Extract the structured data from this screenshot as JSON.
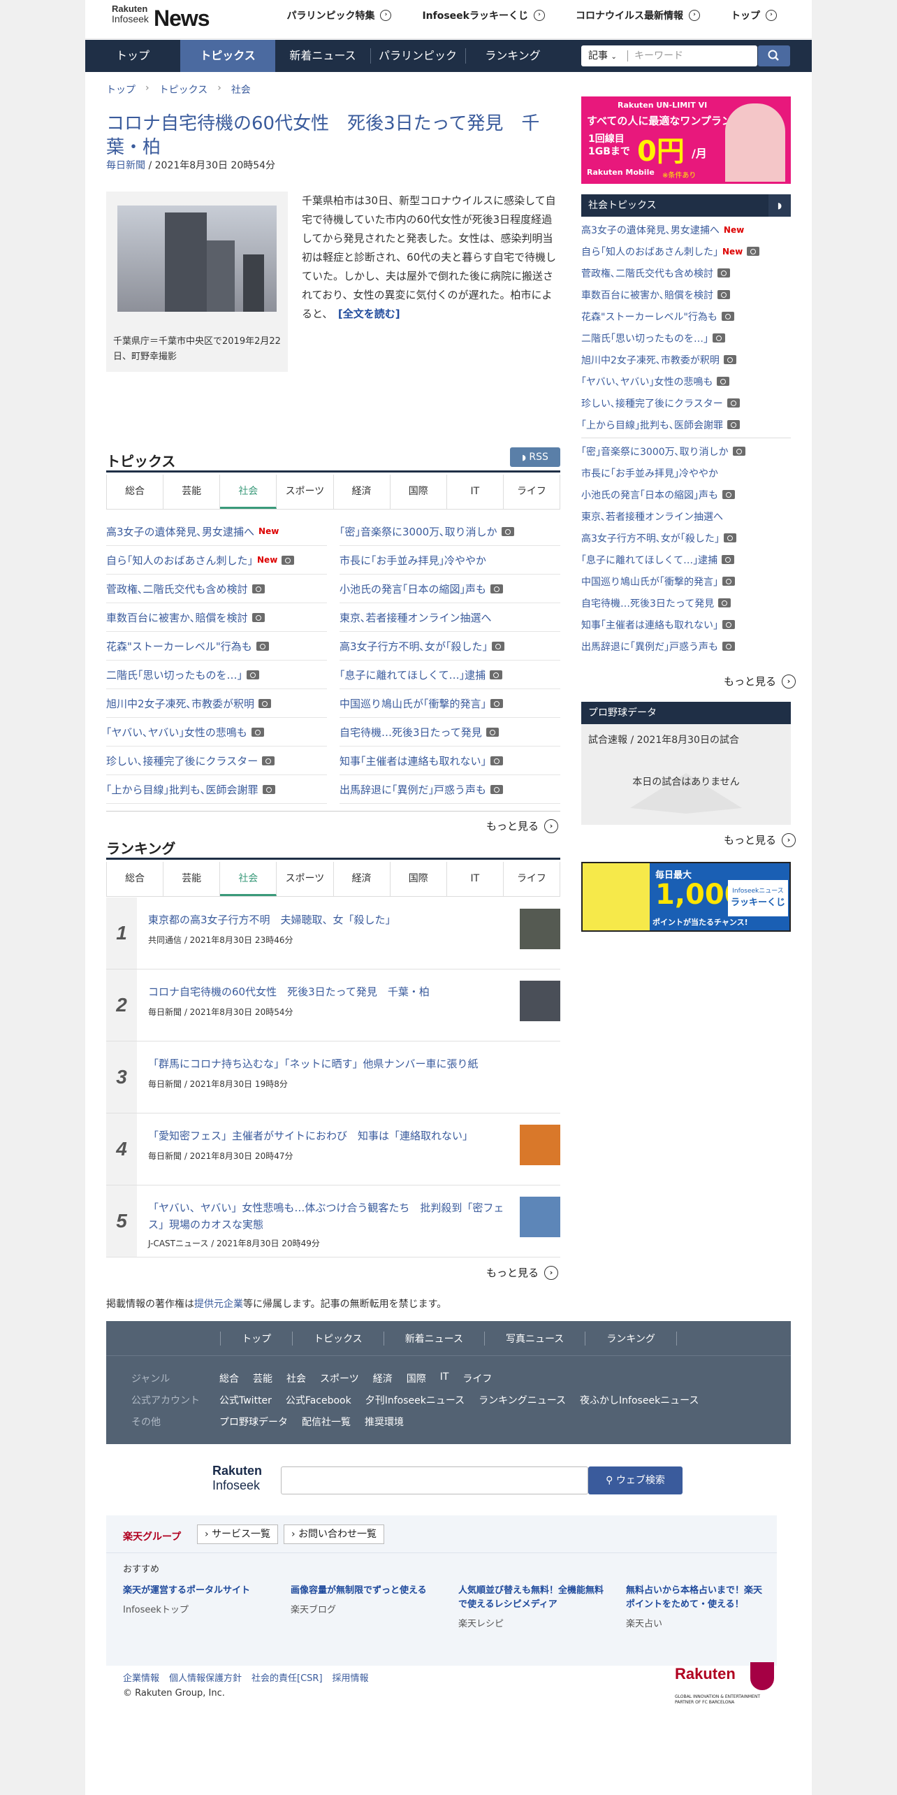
{
  "header": {
    "logo_top": "Rakuten",
    "logo_sub": "Infoseek",
    "logo_news": "News",
    "links": [
      "パラリンピック特集",
      "Infoseekラッキーくじ",
      "コロナウイルス最新情報",
      "トップ"
    ]
  },
  "nav": {
    "tabs": [
      "トップ",
      "トピックス",
      "新着ニュース",
      "パラリンピック",
      "ランキング"
    ],
    "active": "トピックス",
    "search_select": "記事",
    "search_placeholder": "キーワード"
  },
  "breadcrumb": [
    "トップ",
    "トピックス",
    "社会"
  ],
  "article": {
    "title": "コロナ自宅待機の60代女性　死後3日たって発見　千葉・柏",
    "source": "毎日新聞",
    "date": "2021年8月30日 20時54分",
    "caption": "千葉県庁＝千葉市中央区で2019年2月22日、町野幸撮影",
    "body": "千葉県柏市は30日、新型コロナウイルスに感染して自宅で待機していた市内の60代女性が死後3日程度経過してから発見されたと発表した。女性は、感染判明当初は軽症と診断され、60代の夫と暮らす自宅で待機していた。しかし、夫は屋外で倒れた後に病院に搬送されており、女性の異変に気付くのが遅れた。柏市によると、",
    "read_more": "[全文を読む]"
  },
  "topics": {
    "heading": "トピックス",
    "rss": "RSS",
    "tabs": [
      "総合",
      "芸能",
      "社会",
      "スポーツ",
      "経済",
      "国際",
      "IT",
      "ライフ"
    ],
    "active_tab": "社会",
    "left": [
      {
        "text": "高3女子の遺体発見､男女逮捕へ",
        "new": "New",
        "cam": false
      },
      {
        "text": "自ら｢知人のおばあさん刺した｣",
        "new": "New",
        "cam": true
      },
      {
        "text": "菅政権､二階氏交代も含め検討",
        "new": "",
        "cam": true
      },
      {
        "text": "車数百台に被害か､賠償を検討",
        "new": "",
        "cam": true
      },
      {
        "text": "花森\"ストーカーレベル\"行為も",
        "new": "",
        "cam": true
      },
      {
        "text": "二階氏｢思い切ったものを…｣",
        "new": "",
        "cam": true
      },
      {
        "text": "旭川中2女子凍死､市教委が釈明",
        "new": "",
        "cam": true
      },
      {
        "text": "｢ヤバい､ヤバい｣女性の悲鳴も",
        "new": "",
        "cam": true
      },
      {
        "text": "珍しい､接種完了後にクラスター",
        "new": "",
        "cam": true
      },
      {
        "text": "｢上から目線｣批判も､医師会謝罪",
        "new": "",
        "cam": true
      }
    ],
    "right": [
      {
        "text": "｢密｣音楽祭に3000万､取り消しか",
        "cam": true
      },
      {
        "text": "市長に｢お手並み拝見｣冷ややか",
        "cam": false
      },
      {
        "text": "小池氏の発言｢日本の縮図｣声も",
        "cam": true
      },
      {
        "text": "東京､若者接種オンライン抽選へ",
        "cam": false
      },
      {
        "text": "高3女子行方不明､女が｢殺した｣",
        "cam": true
      },
      {
        "text": "｢息子に離れてほしくて…｣逮捕",
        "cam": true
      },
      {
        "text": "中国巡り鳩山氏が｢衝撃的発言｣",
        "cam": true
      },
      {
        "text": "自宅待機…死後3日たって発見",
        "cam": true
      },
      {
        "text": "知事｢主催者は連絡も取れない｣",
        "cam": true
      },
      {
        "text": "出馬辞退に｢異例だ｣戸惑う声も",
        "cam": true
      }
    ],
    "more": "もっと見る"
  },
  "ranking": {
    "heading": "ランキング",
    "tabs": [
      "総合",
      "芸能",
      "社会",
      "スポーツ",
      "経済",
      "国際",
      "IT",
      "ライフ"
    ],
    "active_tab": "社会",
    "items": [
      {
        "rank": "1",
        "title": "東京都の高3女子行方不明　夫婦聴取、女「殺した」",
        "meta": "共同通信 / 2021年8月30日 23時46分",
        "thumb": true
      },
      {
        "rank": "2",
        "title": "コロナ自宅待機の60代女性　死後3日たって発見　千葉・柏",
        "meta": "毎日新聞 / 2021年8月30日 20時54分",
        "thumb": true
      },
      {
        "rank": "3",
        "title": "「群馬にコロナ持ち込むな」「ネットに晒す」他県ナンバー車に張り紙",
        "meta": "毎日新聞 / 2021年8月30日 19時8分",
        "thumb": false
      },
      {
        "rank": "4",
        "title": "「愛知密フェス」主催者がサイトにおわび　知事は「連絡取れない」",
        "meta": "毎日新聞 / 2021年8月30日 20時47分",
        "thumb": true
      },
      {
        "rank": "5",
        "title": "「ヤバい、ヤバい」女性悲鳴も…体ぶつけ合う観客たち　批判殺到「密フェス」現場のカオスな実態",
        "meta": "J-CASTニュース / 2021年8月30日 20時49分",
        "thumb": true
      }
    ],
    "more": "もっと見る"
  },
  "copyright_note": "掲載情報の著作権は提供元企業等に帰属します。記事の無断転用を禁じます。",
  "copyright_link": "提供元企業",
  "ad": {
    "brand": "Rakuten UN-LIMIT VI",
    "line1": "すべての人に最適なワンプラン",
    "line2a": "1回線目",
    "line2b": "1GBまで",
    "price": "0円",
    "unit": "/月",
    "mobile": "Rakuten Mobile",
    "note": "※条件あり"
  },
  "sidebar": {
    "heading": "社会トピックス",
    "items": [
      {
        "text": "高3女子の遺体発見､男女逮捕へ",
        "new": "New",
        "cam": false
      },
      {
        "text": "自ら｢知人のおばあさん刺した｣",
        "new": "New",
        "cam": true
      },
      {
        "text": "菅政権､二階氏交代も含め検討",
        "new": "",
        "cam": true
      },
      {
        "text": "車数百台に被害か､賠償を検討",
        "new": "",
        "cam": true
      },
      {
        "text": "花森\"ストーカーレベル\"行為も",
        "new": "",
        "cam": true
      },
      {
        "text": "二階氏｢思い切ったものを…｣",
        "new": "",
        "cam": true
      },
      {
        "text": "旭川中2女子凍死､市教委が釈明",
        "new": "",
        "cam": true
      },
      {
        "text": "｢ヤバい､ヤバい｣女性の悲鳴も",
        "new": "",
        "cam": true
      },
      {
        "text": "珍しい､接種完了後にクラスター",
        "new": "",
        "cam": true
      },
      {
        "text": "｢上から目線｣批判も､医師会謝罪",
        "new": "",
        "cam": true
      },
      {
        "text": "｢密｣音楽祭に3000万､取り消しか",
        "new": "",
        "cam": true
      },
      {
        "text": "市長に｢お手並み拝見｣冷ややか",
        "new": "",
        "cam": false
      },
      {
        "text": "小池氏の発言｢日本の縮図｣声も",
        "new": "",
        "cam": true
      },
      {
        "text": "東京､若者接種オンライン抽選へ",
        "new": "",
        "cam": false
      },
      {
        "text": "高3女子行方不明､女が｢殺した｣",
        "new": "",
        "cam": true
      },
      {
        "text": "｢息子に離れてほしくて…｣逮捕",
        "new": "",
        "cam": true
      },
      {
        "text": "中国巡り鳩山氏が｢衝撃的発言｣",
        "new": "",
        "cam": true
      },
      {
        "text": "自宅待機…死後3日たって発見",
        "new": "",
        "cam": true
      },
      {
        "text": "知事｢主催者は連絡も取れない｣",
        "new": "",
        "cam": true
      },
      {
        "text": "出馬辞退に｢異例だ｣戸惑う声も",
        "new": "",
        "cam": true
      }
    ],
    "more": "もっと見る"
  },
  "baseball": {
    "heading": "プロ野球データ",
    "sub": "試合速報 / 2021年8月30日の試合",
    "none": "本日の試合はありません",
    "more": "もっと見る"
  },
  "lottery": {
    "line1": "毎日最大",
    "amount": "1,000",
    "line2": "ポイントが当たるチャンス!",
    "brand1": "Infoseekニュース",
    "brand2": "ラッキーくじ"
  },
  "footer": {
    "links": [
      "トップ",
      "トピックス",
      "新着ニュース",
      "写真ニュース",
      "ランキング"
    ],
    "genre_label": "ジャンル",
    "genres": [
      "総合",
      "芸能",
      "社会",
      "スポーツ",
      "経済",
      "国際",
      "IT",
      "ライフ"
    ],
    "official_label": "公式アカウント",
    "officials": [
      "公式Twitter",
      "公式Facebook",
      "夕刊Infoseekニュース",
      "ランキングニュース",
      "夜ふかしInfoseekニュース"
    ],
    "other_label": "その他",
    "others": [
      "プロ野球データ",
      "配信社一覧",
      "推奨環境"
    ]
  },
  "gsearch": {
    "logo1": "Rakuten",
    "logo2": "Infoseek",
    "button": "ウェブ検索"
  },
  "rakuten_group": {
    "title": "楽天グループ",
    "btn1": "サービス一覧",
    "btn2": "お問い合わせ一覧",
    "osusume": "おすすめ",
    "cols": [
      {
        "a": "楽天が運営するポータルサイト",
        "b": "Infoseekトップ"
      },
      {
        "a": "画像容量が無制限でずっと使える",
        "b": "楽天ブログ"
      },
      {
        "a": "人気順並び替えも無料！全機能無料で使えるレシピメディア",
        "b": "楽天レシピ"
      },
      {
        "a": "無料占いから本格占いまで！楽天ポイントをためて・使える！",
        "b": "楽天占い"
      }
    ]
  },
  "legal": {
    "links": [
      "企業情報",
      "個人情報保護方針",
      "社会的責任[CSR]",
      "採用情報"
    ],
    "copyright": "© Rakuten Group, Inc.",
    "rakuten_logo": "Rakuten",
    "partner": "GLOBAL INNOVATION & ENTERTAINMENT PARTNER OF FC BARCELONA"
  },
  "colors": {
    "nav": "#1f2f46",
    "accent": "#4b6aa0",
    "link": "#3a5b9c",
    "new": "#dd0000",
    "active_tab": "#3a9a7a"
  }
}
